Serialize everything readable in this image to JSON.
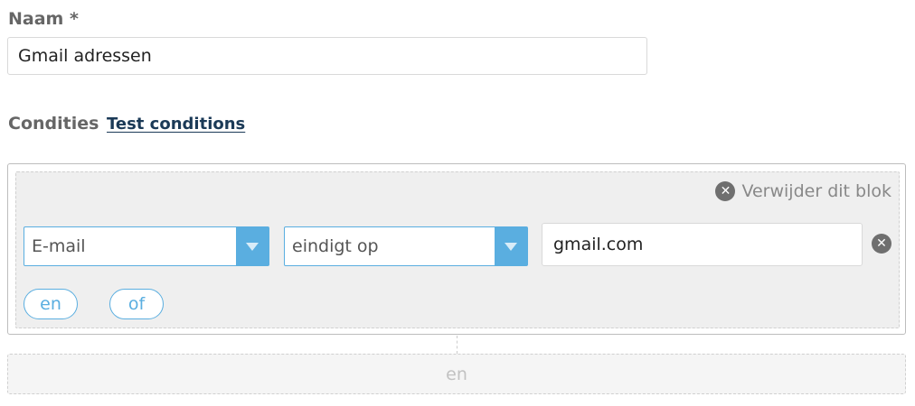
{
  "form": {
    "name_label": "Naam *",
    "name_value": "Gmail adressen"
  },
  "conditions": {
    "label": "Condities",
    "test_link": "Test conditions",
    "block": {
      "remove_label": "Verwijder dit blok",
      "remove_icon": "close-circle-icon",
      "rule": {
        "field": "E-mail",
        "operator": "eindigt op",
        "value": "gmail.com"
      },
      "and_button": "en",
      "or_button": "of"
    },
    "add_and_block": "en"
  },
  "colors": {
    "accent": "#5aaee0",
    "label_gray": "#666666",
    "link_dark": "#1b3a57",
    "block_bg": "#efefef"
  }
}
